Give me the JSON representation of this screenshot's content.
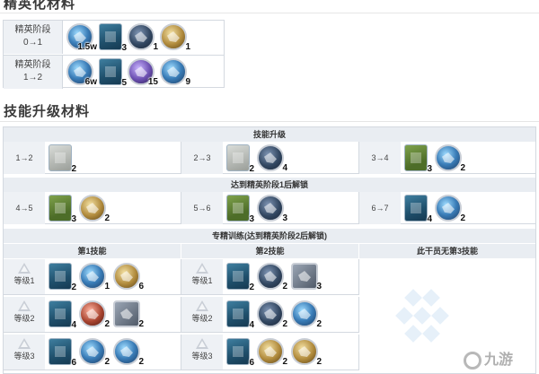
{
  "elite": {
    "title": "精英化材料",
    "rows": [
      {
        "label1": "精英阶段",
        "label2": "0→1",
        "items": [
          {
            "icon": "lmd-coin-icon",
            "qty": "1.5w",
            "style": "blue"
          },
          {
            "icon": "chip-icon",
            "qty": "3",
            "style": "sq"
          },
          {
            "icon": "alloy-icon",
            "qty": "1",
            "style": ""
          },
          {
            "icon": "device-icon",
            "qty": "1",
            "style": "gold"
          }
        ]
      },
      {
        "label1": "精英阶段",
        "label2": "1→2",
        "items": [
          {
            "icon": "lmd-coin-icon",
            "qty": "6w",
            "style": "blue"
          },
          {
            "icon": "dualchip-icon",
            "qty": "5",
            "style": "sq"
          },
          {
            "icon": "crystal-icon",
            "qty": "15",
            "style": "purple"
          },
          {
            "icon": "manganese-icon",
            "qty": "9",
            "style": "blue"
          }
        ]
      }
    ]
  },
  "skill": {
    "title": "技能升级材料",
    "upgrade_header": "技能升级",
    "unlock1_header": "达到精英阶段1后解锁",
    "mastery_header": "专精训练(达到精英阶段2后解锁)",
    "col1": "第1技能",
    "col2": "第2技能",
    "col3": "此干员无第3技能",
    "upgrade_rows": [
      [
        {
          "label": "1→2",
          "items": [
            {
              "icon": "skill-summary-1-icon",
              "qty": "2",
              "style": "sq grey"
            }
          ]
        },
        {
          "label": "2→3",
          "items": [
            {
              "icon": "skill-summary-1-icon",
              "qty": "2",
              "style": "sq grey"
            },
            {
              "icon": "ester-icon",
              "qty": "4",
              "style": ""
            }
          ]
        },
        {
          "label": "3→4",
          "items": [
            {
              "icon": "skill-summary-2-icon",
              "qty": "3",
              "style": "sq green"
            },
            {
              "icon": "oriron-icon",
              "qty": "2",
              "style": "blue"
            }
          ]
        }
      ],
      [
        {
          "label": "4→5",
          "items": [
            {
              "icon": "skill-summary-2-icon",
              "qty": "3",
              "style": "sq green"
            },
            {
              "icon": "device-icon",
              "qty": "2",
              "style": "gold"
            }
          ]
        },
        {
          "label": "5→6",
          "items": [
            {
              "icon": "skill-summary-2-icon",
              "qty": "3",
              "style": "sq green"
            },
            {
              "icon": "polyketon-icon",
              "qty": "3",
              "style": ""
            }
          ]
        },
        {
          "label": "6→7",
          "items": [
            {
              "icon": "skill-summary-3-icon",
              "qty": "4",
              "style": "sq"
            },
            {
              "icon": "grindstone-icon",
              "qty": "2",
              "style": "blue"
            }
          ]
        }
      ]
    ],
    "mastery_rows": [
      {
        "label": "等级1",
        "s1": [
          {
            "icon": "skill-summary-3-icon",
            "qty": "2",
            "style": "sq"
          },
          {
            "icon": "crystal-circuit-icon",
            "qty": "1",
            "style": "blue"
          },
          {
            "icon": "rma-icon",
            "qty": "6",
            "style": "gold"
          }
        ],
        "s2": [
          {
            "icon": "skill-summary-3-icon",
            "qty": "2",
            "style": "sq"
          },
          {
            "icon": "optimized-device-icon",
            "qty": "2",
            "style": ""
          },
          {
            "icon": "keton-colloid-icon",
            "qty": "3",
            "style": "cube"
          }
        ]
      },
      {
        "label": "等级2",
        "s1": [
          {
            "icon": "skill-summary-3-icon",
            "qty": "4",
            "style": "sq"
          },
          {
            "icon": "gel-icon",
            "qty": "2",
            "style": "red"
          },
          {
            "icon": "incandescent-alloy-icon",
            "qty": "2",
            "style": "cube"
          }
        ],
        "s2": [
          {
            "icon": "skill-summary-3-icon",
            "qty": "4",
            "style": "sq"
          },
          {
            "icon": "white-horse-kohl-icon",
            "qty": "2",
            "style": ""
          },
          {
            "icon": "manganese-trihydrate-icon",
            "qty": "2",
            "style": "blue"
          }
        ]
      },
      {
        "label": "等级3",
        "s1": [
          {
            "icon": "skill-summary-3-icon",
            "qty": "6",
            "style": "sq"
          },
          {
            "icon": "bipolar-nanoflake-icon",
            "qty": "2",
            "style": "blue"
          },
          {
            "icon": "polymerization-prep-icon",
            "qty": "2",
            "style": "blue"
          }
        ],
        "s2": [
          {
            "icon": "skill-summary-3-icon",
            "qty": "6",
            "style": "sq"
          },
          {
            "icon": "d32-steel-icon",
            "qty": "2",
            "style": "gold"
          },
          {
            "icon": "crystalline-component-icon",
            "qty": "2",
            "style": "gold"
          }
        ]
      }
    ]
  },
  "logo_text": "九游"
}
